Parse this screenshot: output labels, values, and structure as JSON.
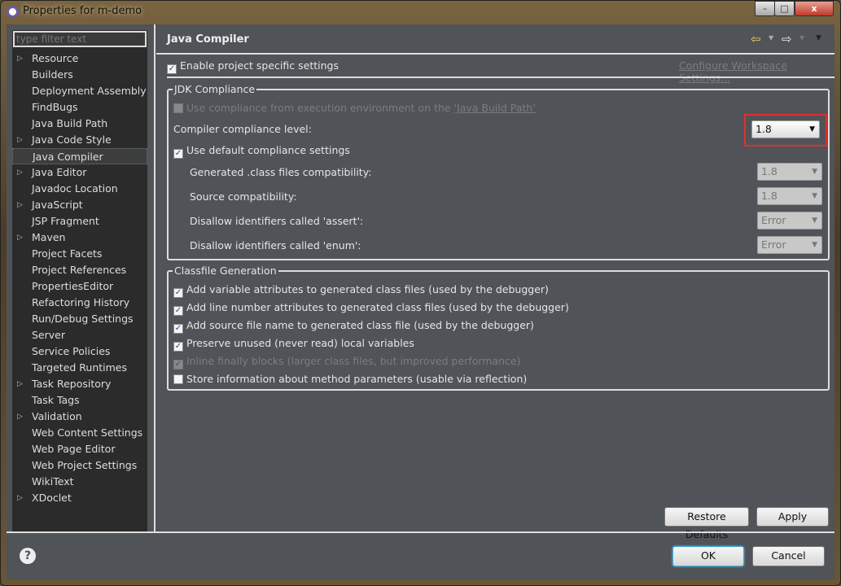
{
  "window": {
    "title": "Properties for m-demo",
    "controls": {
      "minimize": "–",
      "maximize": "□",
      "close": "x"
    }
  },
  "filter": {
    "placeholder": "type filter text"
  },
  "tree": [
    {
      "label": "Resource",
      "expandable": true
    },
    {
      "label": "Builders"
    },
    {
      "label": "Deployment Assembly"
    },
    {
      "label": "FindBugs"
    },
    {
      "label": "Java Build Path"
    },
    {
      "label": "Java Code Style",
      "expandable": true
    },
    {
      "label": "Java Compiler",
      "selected": true
    },
    {
      "label": "Java Editor",
      "expandable": true
    },
    {
      "label": "Javadoc Location"
    },
    {
      "label": "JavaScript",
      "expandable": true
    },
    {
      "label": "JSP Fragment"
    },
    {
      "label": "Maven",
      "expandable": true
    },
    {
      "label": "Project Facets"
    },
    {
      "label": "Project References"
    },
    {
      "label": "PropertiesEditor"
    },
    {
      "label": "Refactoring History"
    },
    {
      "label": "Run/Debug Settings"
    },
    {
      "label": "Server"
    },
    {
      "label": "Service Policies"
    },
    {
      "label": "Targeted Runtimes"
    },
    {
      "label": "Task Repository",
      "expandable": true
    },
    {
      "label": "Task Tags"
    },
    {
      "label": "Validation",
      "expandable": true
    },
    {
      "label": "Web Content Settings"
    },
    {
      "label": "Web Page Editor"
    },
    {
      "label": "Web Project Settings"
    },
    {
      "label": "WikiText"
    },
    {
      "label": "XDoclet",
      "expandable": true
    }
  ],
  "page": {
    "title": "Java Compiler",
    "nav_icons": [
      "back-arrow-icon",
      "forward-arrow-icon",
      "view-menu-icon"
    ],
    "enable_specific": {
      "label": "Enable project specific settings",
      "checked": true
    },
    "configure_link": "Configure Workspace Settings...",
    "jdk": {
      "title": "JDK Compliance",
      "use_ee": {
        "label": "Use compliance from execution environment on the ",
        "link": "'Java Build Path'",
        "checked": false,
        "enabled": false
      },
      "level_label": "Compiler compliance level:",
      "level_value": "1.8",
      "use_default": {
        "label": "Use default compliance settings",
        "checked": true
      },
      "rows": [
        {
          "label": "Generated .class files compatibility:",
          "value": "1.8"
        },
        {
          "label": "Source compatibility:",
          "value": "1.8"
        },
        {
          "label": "Disallow identifiers called 'assert':",
          "value": "Error"
        },
        {
          "label": "Disallow identifiers called 'enum':",
          "value": "Error"
        }
      ]
    },
    "classfile": {
      "title": "Classfile Generation",
      "options": [
        {
          "label": "Add variable attributes to generated class files (used by the debugger)",
          "checked": true,
          "enabled": true
        },
        {
          "label": "Add line number attributes to generated class files (used by the debugger)",
          "checked": true,
          "enabled": true
        },
        {
          "label": "Add source file name to generated class file (used by the debugger)",
          "checked": true,
          "enabled": true
        },
        {
          "label": "Preserve unused (never read) local variables",
          "checked": true,
          "enabled": true
        },
        {
          "label": "Inline finally blocks (larger class files, but improved performance)",
          "checked": true,
          "enabled": false
        },
        {
          "label": "Store information about method parameters (usable via reflection)",
          "checked": false,
          "enabled": true
        }
      ]
    },
    "restore_defaults": "Restore Defaults",
    "apply": "Apply"
  },
  "footer": {
    "help": "?",
    "ok": "OK",
    "cancel": "Cancel"
  },
  "colors": {
    "highlight": "#e03030",
    "background": "#505357",
    "tree": "#2b2b2b"
  }
}
